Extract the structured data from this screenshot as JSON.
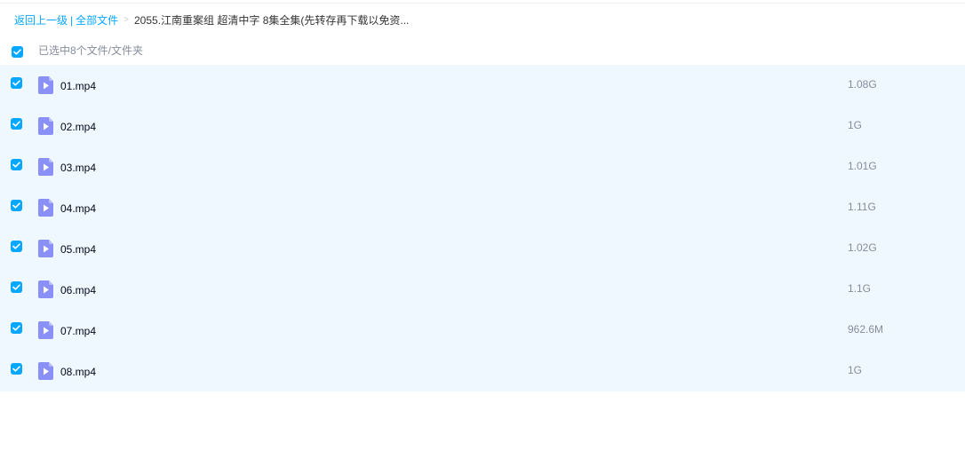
{
  "breadcrumb": {
    "back_label": "返回上一级",
    "separator_bar": "|",
    "all_files_label": "全部文件",
    "separator_arrow": ">",
    "current_folder": "2055.江南重案组 超清中字 8集全集(先转存再下载以免资..."
  },
  "selection": {
    "summary": "已选中8个文件/文件夹",
    "all_checked": true
  },
  "files": [
    {
      "name": "01.mp4",
      "size": "1.08G",
      "checked": true,
      "icon": "video-file-icon"
    },
    {
      "name": "02.mp4",
      "size": "1G",
      "checked": true,
      "icon": "video-file-icon"
    },
    {
      "name": "03.mp4",
      "size": "1.01G",
      "checked": true,
      "icon": "video-file-icon"
    },
    {
      "name": "04.mp4",
      "size": "1.11G",
      "checked": true,
      "icon": "video-file-icon"
    },
    {
      "name": "05.mp4",
      "size": "1.02G",
      "checked": true,
      "icon": "video-file-icon"
    },
    {
      "name": "06.mp4",
      "size": "1.1G",
      "checked": true,
      "icon": "video-file-icon"
    },
    {
      "name": "07.mp4",
      "size": "962.6M",
      "checked": true,
      "icon": "video-file-icon"
    },
    {
      "name": "08.mp4",
      "size": "1G",
      "checked": true,
      "icon": "video-file-icon"
    }
  ],
  "colors": {
    "accent": "#06a7ff",
    "row_background": "#f0f8ff",
    "icon_purple": "#8b8ff8",
    "muted_text": "#878c9c"
  }
}
